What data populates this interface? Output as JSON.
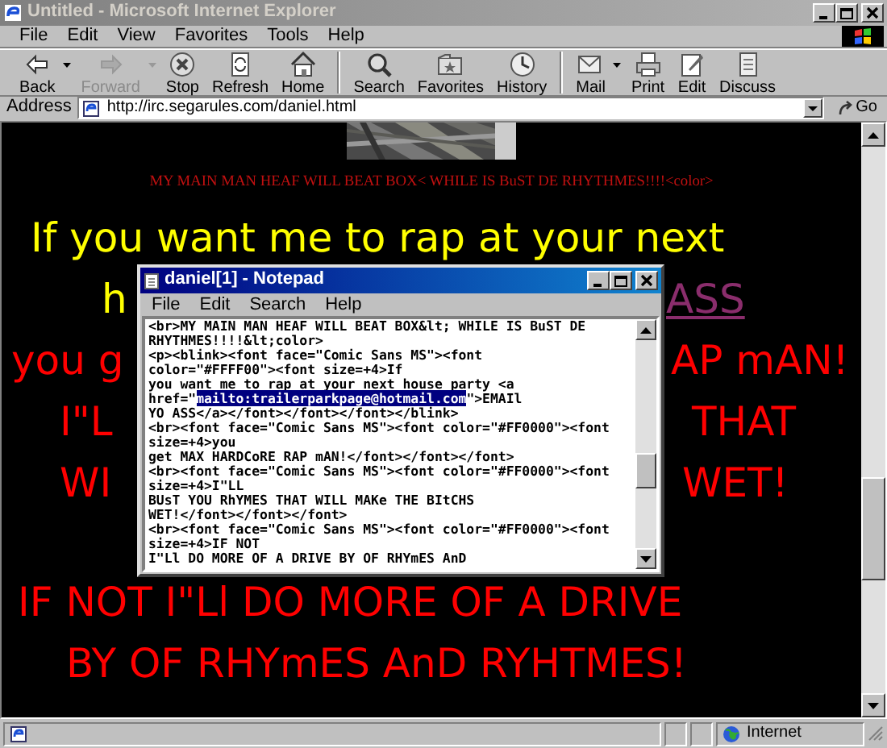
{
  "window": {
    "title": "Untitled - Microsoft Internet Explorer",
    "active": false
  },
  "menu": [
    "File",
    "Edit",
    "View",
    "Favorites",
    "Tools",
    "Help"
  ],
  "toolbar": [
    [
      {
        "label": "Back",
        "disabled": false,
        "dropdown": true
      },
      {
        "label": "Forward",
        "disabled": true,
        "dropdown": true
      },
      {
        "label": "Stop",
        "disabled": false,
        "dropdown": false
      },
      {
        "label": "Refresh",
        "disabled": false,
        "dropdown": false
      },
      {
        "label": "Home",
        "disabled": false,
        "dropdown": false
      }
    ],
    [
      {
        "label": "Search",
        "disabled": false,
        "dropdown": false
      },
      {
        "label": "Favorites",
        "disabled": false,
        "dropdown": false
      },
      {
        "label": "History",
        "disabled": false,
        "dropdown": false
      }
    ],
    [
      {
        "label": "Mail",
        "disabled": false,
        "dropdown": true
      },
      {
        "label": "Print",
        "disabled": false,
        "dropdown": false
      },
      {
        "label": "Edit",
        "disabled": false,
        "dropdown": false
      },
      {
        "label": "Discuss",
        "disabled": false,
        "dropdown": false
      }
    ]
  ],
  "address_bar": {
    "label": "Address",
    "url": "http://irc.segarules.com/daniel.html",
    "go": "Go"
  },
  "page": {
    "caption": "MY MAIN MAN HEAF WILL BEAT BOX< WHILE IS BuST DE RHYTHMES!!!!<color>",
    "lines": [
      {
        "color": "#ffff00",
        "parts": [
          {
            "text": "If you want me to rap at your next",
            "kind": "text"
          }
        ]
      },
      {
        "color": "#ffff00",
        "parts": [
          {
            "text": "h",
            "kind": "text"
          },
          {
            "text": "ASS",
            "kind": "link"
          }
        ]
      },
      {
        "color": "#ff0000",
        "parts": [
          {
            "text": "you g",
            "kind": "text"
          },
          {
            "text": "AP mAN!",
            "kind": "text"
          }
        ]
      },
      {
        "color": "#ff0000",
        "parts": [
          {
            "text": "I\"L",
            "kind": "text"
          },
          {
            "text": "THAT",
            "kind": "text"
          }
        ]
      },
      {
        "color": "#ff0000",
        "parts": [
          {
            "text": "WI",
            "kind": "text"
          },
          {
            "text": "WET!",
            "kind": "text"
          }
        ]
      },
      {
        "color": "#ff0000",
        "parts": [
          {
            "text": "IF NOT I\"Ll DO MORE OF A DRIVE",
            "kind": "text"
          }
        ]
      },
      {
        "color": "#ff0000",
        "parts": [
          {
            "text": "BY OF RHYmES AnD RYHTMES!",
            "kind": "text"
          }
        ]
      }
    ]
  },
  "status_bar": {
    "zone": "Internet"
  },
  "notepad": {
    "title": "daniel[1] - Notepad",
    "active": true,
    "menu": [
      "File",
      "Edit",
      "Search",
      "Help"
    ],
    "lines": [
      "<br>MY MAIN MAN HEAF WILL BEAT BOX&lt; WHILE IS BuST DE",
      "RHYTHMES!!!!&lt;color>",
      "<p><blink><font face=\"Comic Sans MS\"><font",
      "color=\"#FFFF00\"><font size=+4>If",
      "you want me to rap at your next house party <a",
      {
        "segments": [
          {
            "text": "href=\"",
            "selected": false
          },
          {
            "text": "mailto:trailerparkpage@hotmail.com",
            "selected": true
          },
          {
            "text": "\">EMAIl",
            "selected": false
          }
        ]
      },
      "YO ASS</a></font></font></font></blink>",
      "<br><font face=\"Comic Sans MS\"><font color=\"#FF0000\"><font",
      "size=+4>you",
      "get MAX HARDCoRE RAP mAN!</font></font></font>",
      "<br><font face=\"Comic Sans MS\"><font color=\"#FF0000\"><font",
      "size=+4>I\"LL",
      "BUsT YOU RhYMES THAT WILL MAKe THE BItCHS",
      "WET!</font></font></font>",
      "<br><font face=\"Comic Sans MS\"><font color=\"#FF0000\"><font",
      "size=+4>IF NOT",
      "I\"Ll DO MORE OF A DRIVE BY OF RHYmES AnD"
    ]
  }
}
